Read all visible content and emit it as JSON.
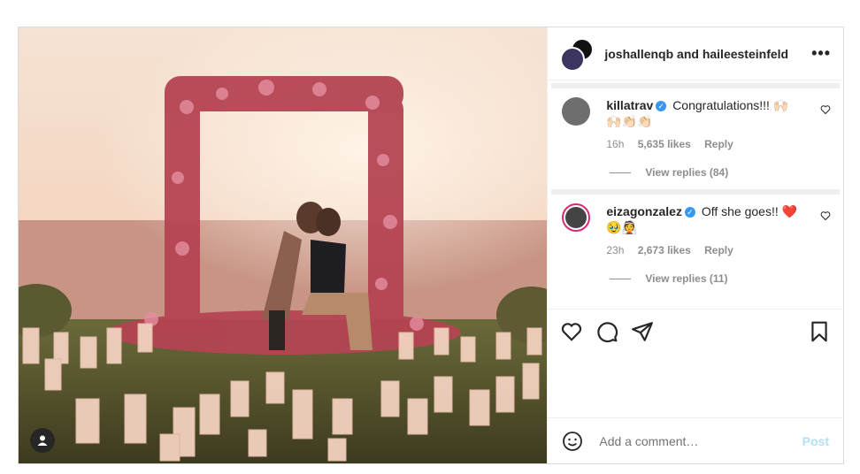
{
  "header": {
    "user1": "joshallenqb",
    "and": " and ",
    "user2": "haileesteinfeld",
    "more_label": "•••"
  },
  "comments": [
    {
      "username": "killatrav",
      "text": "Congratulations!!! 🙌🏻🙌🏻👏🏻👏🏻",
      "time": "16h",
      "likes": "5,635 likes",
      "reply": "Reply",
      "view_replies": "View replies (84)"
    },
    {
      "username": "eizagonzalez",
      "text": "Off she goes!! ❤️🥹👰",
      "time": "23h",
      "likes": "2,673 likes",
      "reply": "Reply",
      "view_replies": "View replies (11)"
    }
  ],
  "add_comment": {
    "placeholder": "Add a comment…",
    "post_label": "Post"
  },
  "icons": [
    "heart-icon",
    "comment-icon",
    "share-icon",
    "bookmark-icon",
    "emoji-icon",
    "user-tag-icon"
  ],
  "colors": {
    "verified": "#3897f0",
    "post_disabled": "#b2dffc"
  }
}
